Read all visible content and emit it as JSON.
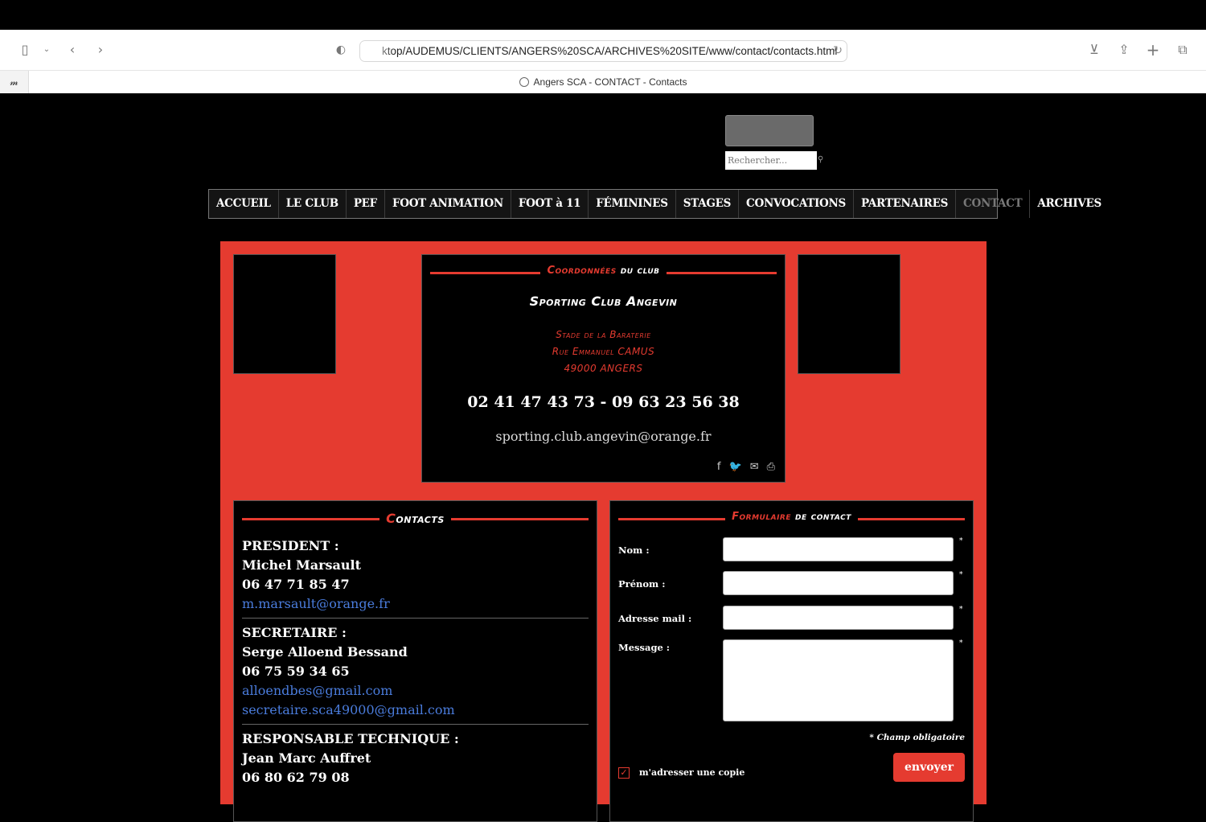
{
  "browser": {
    "url": "ktop/AUDEMUS/CLIENTS/ANGERS%20SCA/ARCHIVES%20SITE/www/contact/contacts.html",
    "tab_title": "Angers SCA - CONTACT - Contacts"
  },
  "search": {
    "placeholder": "Rechercher..."
  },
  "nav": {
    "items": [
      "ACCUEIL",
      "LE CLUB",
      "PEF",
      "FOOT ANIMATION",
      "FOOT à 11",
      "FÉMININES",
      "STAGES",
      "CONVOCATIONS",
      "PARTENAIRES",
      "CONTACT",
      "ARCHIVES"
    ],
    "active": "CONTACT"
  },
  "club": {
    "heading_red": "Coordonnées",
    "heading_white": "du club",
    "name": "Sporting Club Angevin",
    "address1": "Stade de la Baraterie",
    "address2": "Rue Emmanuel CAMUS",
    "address3": "49000 ANGERS",
    "phone": "02 41 47 43 73 - 09 63 23 56 38",
    "email": "sporting.club.angevin@orange.fr"
  },
  "contacts": {
    "heading_red": "C",
    "heading_white": "ontacts",
    "president": {
      "role": "PRESIDENT :",
      "name": "Michel Marsault",
      "phone": "06 47 71 85 47",
      "email": "m.marsault@orange.fr"
    },
    "secretaire": {
      "role": "SECRETAIRE :",
      "name": "Serge Alloend Bessand",
      "phone": "06 75 59 34 65",
      "email1": "alloendbes@gmail.com",
      "email2": "secretaire.sca49000@gmail.com"
    },
    "technique": {
      "role": "RESPONSABLE TECHNIQUE  :",
      "name": "Jean Marc Auffret",
      "phone": "06 80 62 79 08"
    }
  },
  "form": {
    "heading_red": "Formulaire",
    "heading_white": "de contact",
    "nom": "Nom :",
    "prenom": "Prénom :",
    "mail": "Adresse mail :",
    "message": "Message :",
    "star": "*",
    "required_note": "* Champ obligatoire",
    "copy_label": "m'adresser une copie",
    "send": "envoyer"
  },
  "colors": {
    "accent": "#e53b30",
    "link": "#4a7cdc"
  }
}
